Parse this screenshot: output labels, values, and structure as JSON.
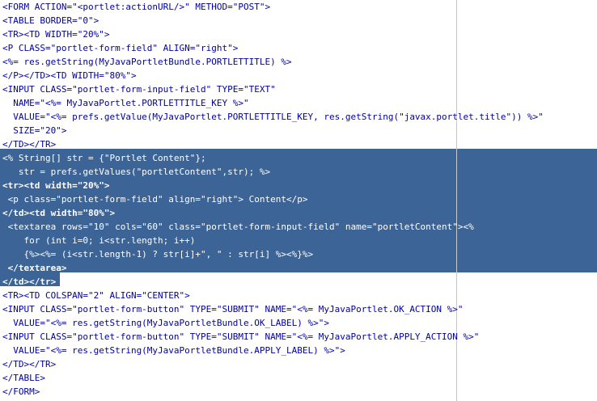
{
  "editor": {
    "lines": [
      {
        "text": "<FORM ACTION=\"<portlet:actionURL/>\" METHOD=\"POST\">",
        "selected": false
      },
      {
        "text": "<TABLE BORDER=\"0\">",
        "selected": false
      },
      {
        "text": "<TR><TD WIDTH=\"20%\">",
        "selected": false
      },
      {
        "text": "<P CLASS=\"portlet-form-field\" ALIGN=\"right\">",
        "selected": false
      },
      {
        "text": "<%= res.getString(MyJavaPortletBundle.PORTLETTITLE) %>",
        "selected": false
      },
      {
        "text": "</P></TD><TD WIDTH=\"80%\">",
        "selected": false
      },
      {
        "text": "<INPUT CLASS=\"portlet-form-input-field\" TYPE=\"TEXT\"",
        "selected": false
      },
      {
        "text": "  NAME=\"<%= MyJavaPortlet.PORTLETTITLE_KEY %>\"",
        "selected": false
      },
      {
        "text": "  VALUE=\"<%= prefs.getValue(MyJavaPortlet.PORTLETTITLE_KEY, res.getString(\"javax.portlet.title\")) %>\"",
        "selected": false
      },
      {
        "text": "  SIZE=\"20\">",
        "selected": false
      },
      {
        "text": "</TD></TR>",
        "selected": false
      },
      {
        "text": "<% String[] str = {\"Portlet Content\"};",
        "selected": true
      },
      {
        "text": "   str = prefs.getValues(\"portletContent\",str); %>",
        "selected": true
      },
      {
        "text": "<tr><td width=\"20%\">",
        "selected": true
      },
      {
        "text": " <p class=\"portlet-form-field\" align=\"right\"> Content</p>",
        "selected": true
      },
      {
        "text": "</td><td width=\"80%\">",
        "selected": true
      },
      {
        "text": " <textarea rows=\"10\" cols=\"60\" class=\"portlet-form-input-field\" name=\"portletContent\"><%",
        "selected": true
      },
      {
        "text": "    for (int i=0; i<str.length; i++)",
        "selected": true
      },
      {
        "text": "    {%><%= (i<str.length-1) ? str[i]+\", \" : str[i] %><%}%>",
        "selected": true
      },
      {
        "text": " </textarea>",
        "selected": true
      },
      {
        "text": "</td></tr>",
        "selected": true
      },
      {
        "text": "<TR><TD COLSPAN=\"2\" ALIGN=\"CENTER\">",
        "selected": false
      },
      {
        "text": "<INPUT CLASS=\"portlet-form-button\" TYPE=\"SUBMIT\" NAME=\"<%= MyJavaPortlet.OK_ACTION %>\"",
        "selected": false
      },
      {
        "text": "  VALUE=\"<%= res.getString(MyJavaPortletBundle.OK_LABEL) %>\">",
        "selected": false
      },
      {
        "text": "<INPUT CLASS=\"portlet-form-button\" TYPE=\"SUBMIT\" NAME=\"<%= MyJavaPortlet.APPLY_ACTION %>\"",
        "selected": false
      },
      {
        "text": "  VALUE=\"<%= res.getString(MyJavaPortletBundle.APPLY_LABEL) %>\">",
        "selected": false
      },
      {
        "text": "</TD></TR>",
        "selected": false
      },
      {
        "text": "</TABLE>",
        "selected": false
      },
      {
        "text": "</FORM>",
        "selected": false
      }
    ]
  },
  "colors": {
    "background": "#ffffff",
    "code_text": "#0000a0",
    "selection_background": "#3c6496",
    "selection_text": "#ffffff",
    "margin_line": "#c9c9c9"
  }
}
